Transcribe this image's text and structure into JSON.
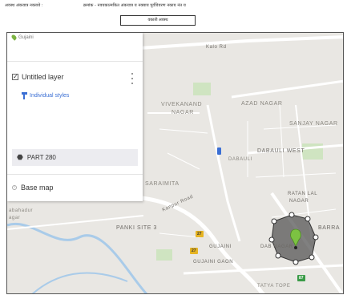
{
  "document": {
    "header_left": "अवस्थ अंकयात्र नक्ताये :",
    "header_right": "क्रमांक - नवयकात्मकित अंकयात्र य नक्याय पूर्वविवरण नकाय नंत य",
    "box_label": "वकाती अवस्थ"
  },
  "panel": {
    "top_label": "Gujaini",
    "layer_name": "Untitled layer",
    "layer_checked": true,
    "styles_link": "Individual styles",
    "feature_name": "PART 280",
    "base_map_label": "Base map"
  },
  "map": {
    "labels": {
      "kalo_rd": "Kalo Rd",
      "vivekanand_1": "VIVEKANAND",
      "vivekanand_2": "NAGAR",
      "azad_nagar": "AZAD NAGAR",
      "sanjay_nagar": "SANJAY NAGAR",
      "dabauli_west": "DABAULI WEST",
      "dabauli": "DABAULI",
      "saraimita": "SARAIMITA",
      "kanpur_road": "Kanpur Road",
      "ratan_lal_1": "RATAN LAL",
      "ratan_lal_2": "NAGAR",
      "barra": "BARRA",
      "panki_site": "PANKI SITE 3",
      "gujaini": "GUJAINI",
      "gujaini_gaon": "GUJAINI GAON",
      "dabauli_nagar": "DAB NAGAR",
      "abadi_1": "abahadur",
      "abadi_2": "agar",
      "tatya_tope": "TATYA TOPE"
    },
    "shields": {
      "s1": "27",
      "s2": "27",
      "s3": "87"
    },
    "colors": {
      "land": "#e9e7e3",
      "road": "#ffffff",
      "river": "#a9cbe9",
      "park": "#cfe4c1",
      "polygon_fill": "#555555",
      "pin": "#7cc242"
    }
  }
}
